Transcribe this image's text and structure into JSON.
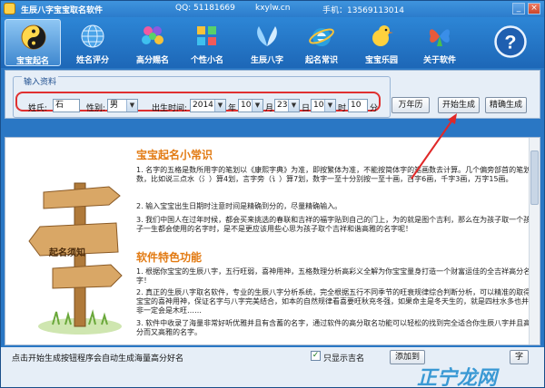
{
  "window": {
    "title": "生辰八字宝宝取名软件",
    "qq": "QQ: 51181669",
    "site": "kxylw.cn",
    "phone": "手机：13569113014"
  },
  "toolbar": {
    "items": [
      {
        "label": "宝宝起名",
        "icon": "yin-yang-icon"
      },
      {
        "label": "姓名评分",
        "icon": "globe-icon"
      },
      {
        "label": "高分赐名",
        "icon": "flower-icon"
      },
      {
        "label": "个性小名",
        "icon": "blocks-icon"
      },
      {
        "label": "生辰八字",
        "icon": "wings-icon"
      },
      {
        "label": "起名常识",
        "icon": "ie-icon"
      },
      {
        "label": "宝宝乐园",
        "icon": "duck-icon"
      },
      {
        "label": "关于软件",
        "icon": "butterfly-icon"
      },
      {
        "label": "",
        "icon": "help-icon"
      }
    ]
  },
  "info": {
    "legend": "输入资料",
    "surname_label": "姓氏:",
    "surname_value": "石",
    "gender_label": "性别:",
    "gender_value": "男",
    "birth_label": "出生时间:",
    "year_value": "2014",
    "year_unit": "年",
    "month_value": "10",
    "month_unit": "月",
    "day_value": "23",
    "day_unit": "日",
    "hour_value": "10",
    "hour_unit": "时",
    "minute_value": "10",
    "minute_unit": "分",
    "calendar_button": "万年历",
    "start_button": "开始生成",
    "precise_button": "精确生成"
  },
  "content": {
    "sign_text": "起名须知",
    "tips_title": "宝宝起名小常识",
    "tips": [
      "1. 名字的五格是数所用字的笔划以《康熙字典》为准，即按繁体为准，不能按简体字的笔画数去计算。几个偏旁部首的笔划数，比如说三点水（氵）算4划，言字旁（讠）算7划，数字一至十分别按一至十画，百字6画，千字3画，万字15画。",
      "2. 输入宝宝出生日期时注意时间是精确到分的，尽量精确输入。",
      "3. 我们中国人在过年时候，都会买来挑选的春联和吉祥的福字贴到自己的门上，为的就是图个吉利，那么在为孩子取一个孩子一生都会使用的名字时，是不是更应该用些心思为孩子取个吉祥和谐高雅的名字呢！"
    ],
    "features_title": "软件特色功能",
    "features": [
      "1. 根据你宝宝的生辰八字，五行旺弱，喜神用神，五格数理分析高彩义全解为你宝宝量身打造一个财富运佳的全吉祥高分名字！",
      "2. 真正的生辰八字取名软件，专业的生辰八字分析系统，完全根据五行不同季节的旺衰规律综合判断分析，可以精准的取得宝宝的喜神用神，保证名字与八字完美结合，如本的自然规律看喜要旺秋充冬强，如果命主是冬天生的，就是四柱水多也并非一定会是木旺……",
      "3. 软件中收录了海量非常好听优雅并且有含蓄的名字，通过软件的高分取名功能可以轻松的找到完全适合你生辰八字并且高分而又高雅的名字。"
    ]
  },
  "status": {
    "text": "点击开始生成按钮程序会自动生成海量高分好名",
    "checkbox_label": "只显示吉名",
    "checkbox_checked": true,
    "add_button": "添加到",
    "name_button": "字",
    "watermark": "正宁龙网"
  }
}
